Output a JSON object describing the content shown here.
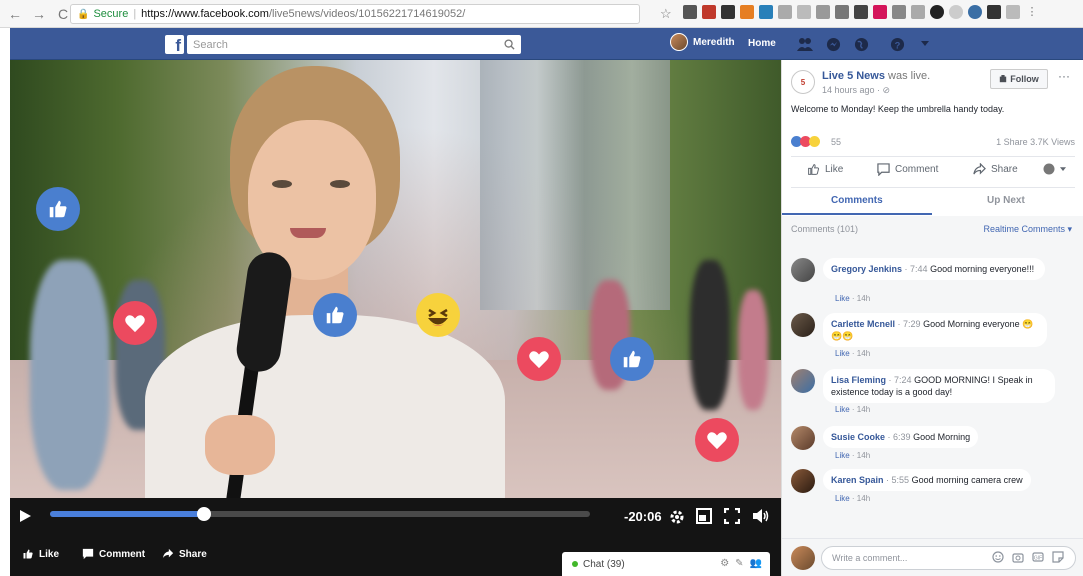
{
  "browser": {
    "secure_label": "Secure",
    "url_host": "https://www.facebook.com",
    "url_path": "/live5news/videos/10156221714619052/"
  },
  "header": {
    "search_placeholder": "Search",
    "user_name": "Meredith",
    "home_label": "Home"
  },
  "video": {
    "progress_fraction": 0.285,
    "time_remaining": "-20:06"
  },
  "video_actions": {
    "like_label": "Like",
    "comment_label": "Comment",
    "share_label": "Share",
    "chat_label": "Chat (39)"
  },
  "post": {
    "page_name": "Live 5 News",
    "status": "was live.",
    "time": "14 hours ago · ⊘",
    "follow_label": "Follow",
    "text": "Welcome to Monday! Keep the umbrella handy today.",
    "reaction_count": "55",
    "share_views": "1 Share  3.7K Views",
    "like_label": "Like",
    "comment_label": "Comment",
    "share_label": "Share"
  },
  "tabs": {
    "comments": "Comments",
    "up_next": "Up Next"
  },
  "comments_header": {
    "count": "Comments (101)",
    "sort": "Realtime Comments ▾"
  },
  "comments": [
    {
      "author": "Gregory Jenkins",
      "time": "· 7:44",
      "text": "Good morning everyone!!!",
      "like": "Like",
      "age": "· 14h"
    },
    {
      "author": "Carlette Mcnell",
      "time": "· 7:29",
      "text": "Good Morning everyone 😁😁😁",
      "like": "Like",
      "age": "· 14h"
    },
    {
      "author": "Lisa Fleming",
      "time": "· 7:24",
      "text": "GOOD MORNING! I Speak in existence today is a good day!",
      "like": "Like",
      "age": "· 14h"
    },
    {
      "author": "Susie Cooke",
      "time": "· 6:39",
      "text": "Good Morning",
      "like": "Like",
      "age": "· 14h"
    },
    {
      "author": "Karen Spain",
      "time": "· 5:55",
      "text": "Good morning camera crew",
      "like": "Like",
      "age": "· 14h"
    }
  ],
  "comment_input": {
    "placeholder": "Write a comment..."
  },
  "colors": {
    "facebook_blue": "#3b5998",
    "link_blue": "#365899",
    "like_reaction": "#4a7fcf",
    "love_reaction": "#ec4a5f",
    "haha_reaction": "#f7d23c"
  }
}
